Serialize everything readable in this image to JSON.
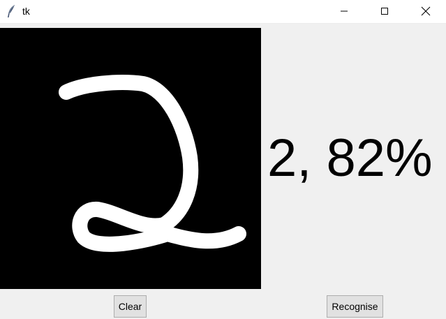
{
  "window": {
    "title": "tk"
  },
  "prediction": {
    "text": "2, 82%",
    "digit": "2",
    "confidence": "82%"
  },
  "buttons": {
    "clear_label": "Clear",
    "recognise_label": "Recognise"
  },
  "icons": {
    "app": "feather-icon",
    "minimize": "minimize-icon",
    "maximize": "maximize-icon",
    "close": "close-icon"
  },
  "colors": {
    "canvas_background": "#000000",
    "stroke": "#ffffff",
    "window_background": "#f0f0f0"
  }
}
